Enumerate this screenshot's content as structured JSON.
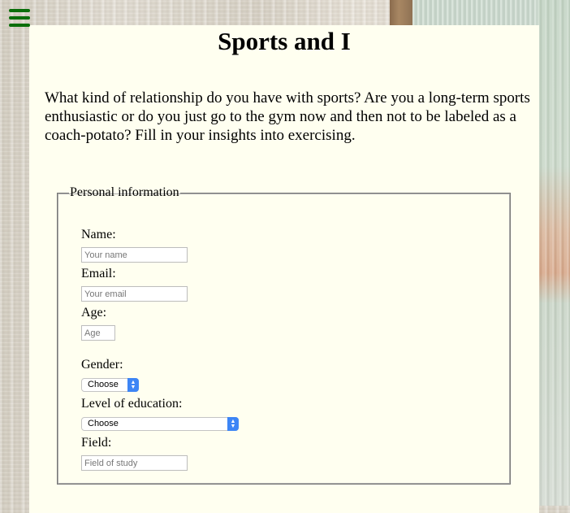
{
  "page": {
    "title": "Sports and I",
    "intro": "What kind of relationship do you have with sports? Are you a long-term sports enthusiastic or do you just go to the gym now and then not to be labeled as a coach-potato? Fill in your insights into exercising."
  },
  "menu": {
    "icon": "hamburger-menu-icon",
    "color": "#0a6e0a"
  },
  "form": {
    "legend": "Personal information",
    "name": {
      "label": "Name:",
      "placeholder": "Your name",
      "value": ""
    },
    "email": {
      "label": "Email:",
      "placeholder": "Your email",
      "value": ""
    },
    "age": {
      "label": "Age:",
      "placeholder": "Age",
      "value": ""
    },
    "gender": {
      "label": "Gender:",
      "selected": "Choose"
    },
    "education": {
      "label": "Level of education:",
      "selected": "Choose"
    },
    "field": {
      "label": "Field:",
      "placeholder": "Field of study",
      "value": ""
    }
  },
  "colors": {
    "panel_background": "#fffff0",
    "select_accent": "#3d85f5"
  }
}
